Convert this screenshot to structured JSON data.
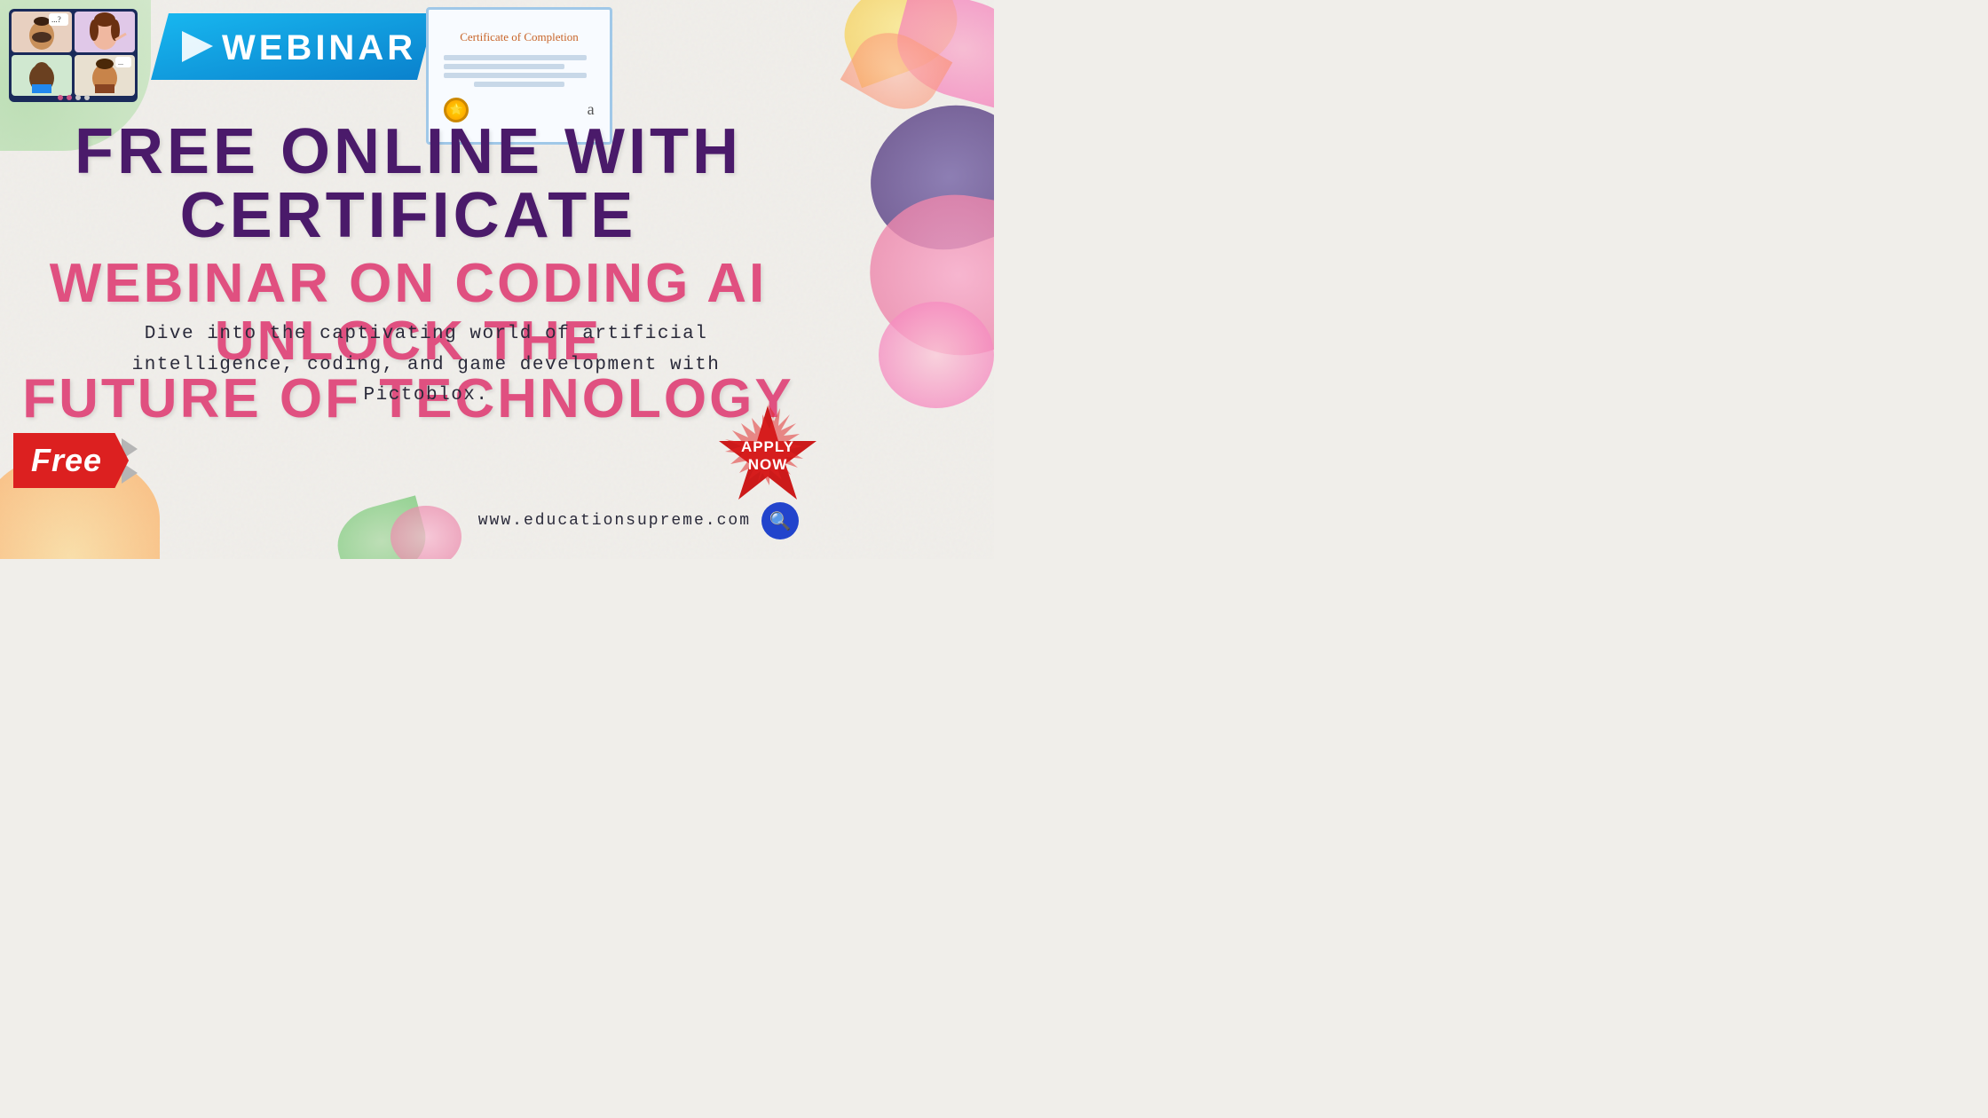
{
  "page": {
    "background": "#f0eeea"
  },
  "header": {
    "webinar_label": "WEBINAR",
    "certificate_title": "Certificate of Completion",
    "certificate_signature": "a",
    "medal_symbol": "★"
  },
  "main": {
    "title_line1": "FREE ONLINE WITH CERTIFICATE",
    "title_line2_part1": "WEBINAR ON CODING AI UNLOCK THE",
    "title_line2_part2": "FUTURE OF TECHNOLOGY",
    "description": "Dive into the captivating world of artificial intelligence, coding, and game development with Pictoblox."
  },
  "badges": {
    "free_label": "Free",
    "apply_line1": "APPLY",
    "apply_line2": "NOW"
  },
  "footer": {
    "website_url": "www.educationsupreme.com",
    "search_icon": "🔍"
  }
}
